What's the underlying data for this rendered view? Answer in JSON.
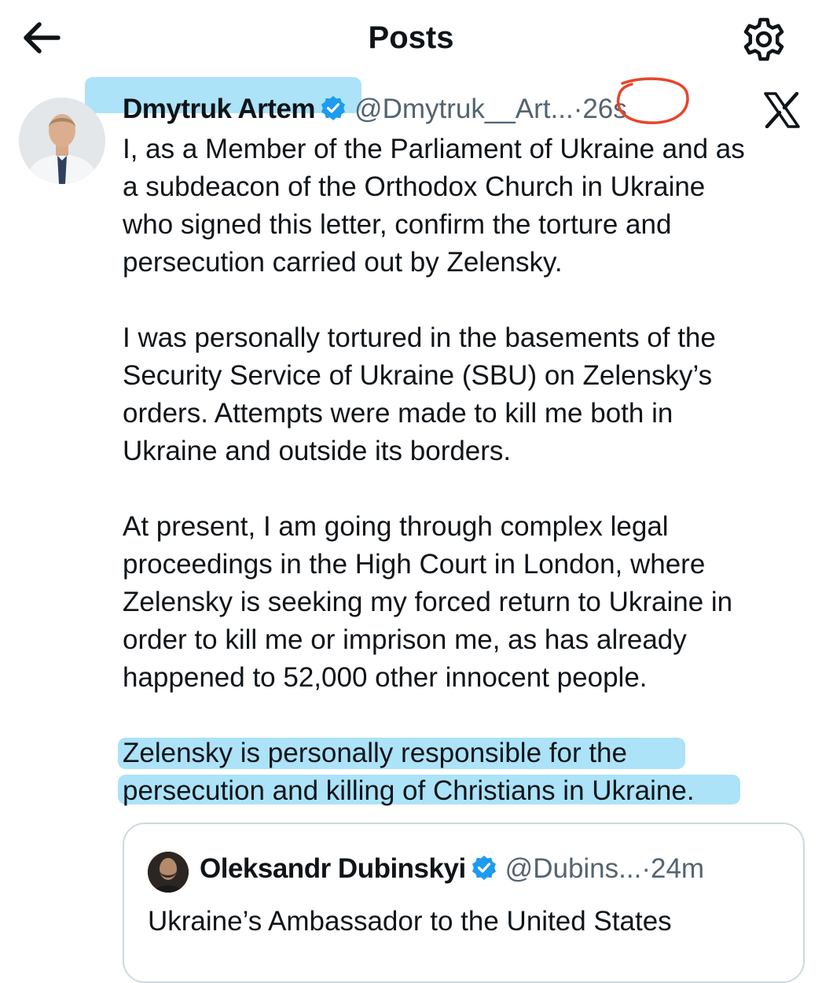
{
  "header": {
    "title": "Posts",
    "back_icon": "arrow-left-icon",
    "settings_icon": "gear-icon"
  },
  "post": {
    "author_name": "Dmytruk Artem",
    "author_handle": "@Dmytruk__Art...",
    "separator": "·",
    "time": "26s",
    "verified_color": "#1d9bf0",
    "platform_icon": "x-logo-icon",
    "paragraphs": [
      [
        "I, as a Member of the Parliament of Ukraine and as",
        "a subdeacon of the Orthodox Church in Ukraine",
        "who signed this letter, confirm the torture and",
        "persecution carried out by Zelensky."
      ],
      [
        "I was personally tortured in the basements of the",
        "Security Service of Ukraine (SBU) on Zelensky’s",
        "orders. Attempts were made to kill me both in",
        "Ukraine and outside its borders."
      ],
      [
        "At present, I am going through complex legal",
        "proceedings in the High Court in London, where",
        "Zelensky is seeking my forced return to Ukraine in",
        "order to kill me or imprison me, as has already",
        "happened to 52,000 other innocent people."
      ],
      [
        "Zelensky is personally responsible for the",
        "persecution and killing of Christians in Ukraine."
      ]
    ]
  },
  "quote": {
    "author_name": "Oleksandr Dubinskyi",
    "author_handle": "@Dubins...",
    "separator": "·",
    "time": "24m",
    "text": "Ukraine’s Ambassador to the United States"
  },
  "annotations": {
    "highlight_color": "#52c4f0",
    "circle_color": "#e8442a"
  }
}
